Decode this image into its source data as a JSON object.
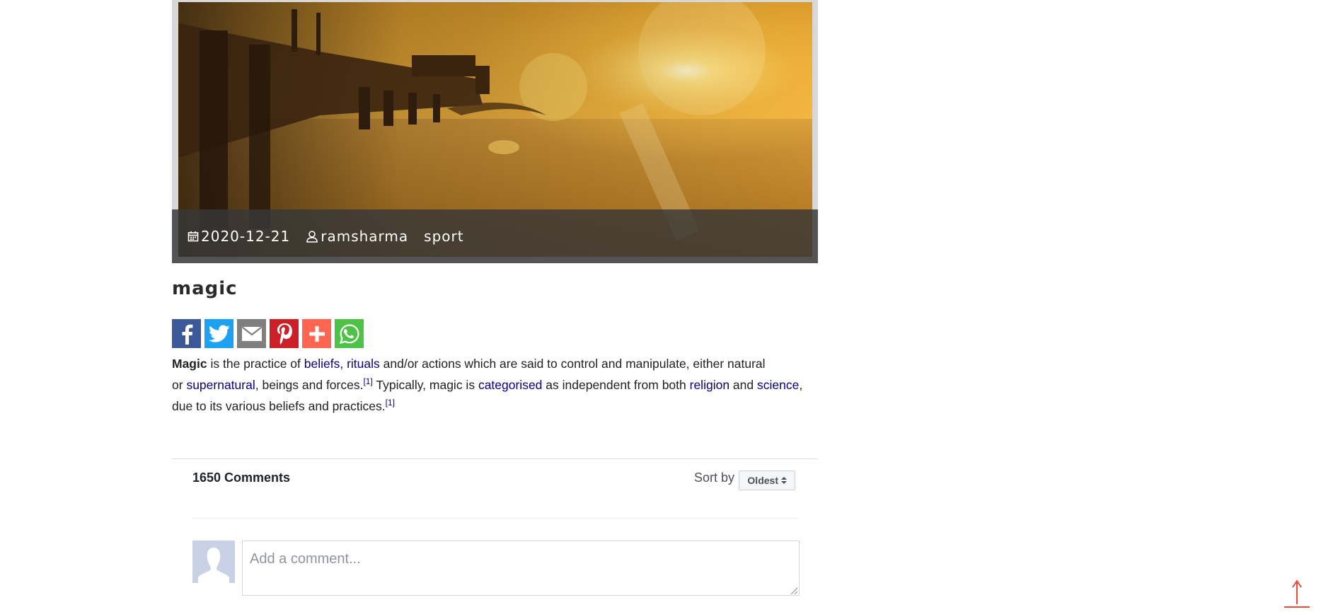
{
  "post": {
    "meta": {
      "date": "2020-12-21",
      "author": "ramsharma",
      "category": "sport"
    },
    "title": "magic",
    "share_buttons": [
      {
        "network": "facebook",
        "icon": "facebook-icon",
        "color": "#3b5998"
      },
      {
        "network": "twitter",
        "icon": "twitter-icon",
        "color": "#1da1f2"
      },
      {
        "network": "email",
        "icon": "email-icon",
        "color": "#7f7f7f"
      },
      {
        "network": "pinterest",
        "icon": "pinterest-icon",
        "color": "#cb2027"
      },
      {
        "network": "more",
        "icon": "plus-icon",
        "color": "#ff6550"
      },
      {
        "network": "whatsapp",
        "icon": "whatsapp-icon",
        "color": "#4dc247"
      }
    ],
    "body": {
      "t0": "Magic",
      "t1": " is the practice of ",
      "l_beliefs": "beliefs",
      "t2": ", ",
      "l_rituals": "rituals",
      "t3": " and/or actions which are said to control and manipulate, either natural",
      "t4": "or ",
      "l_supernatural": "supernatural",
      "t5": ", beings and forces.",
      "ref1": "[1]",
      "t6": " Typically, magic is ",
      "l_categorised": "categorised",
      "t7": " as independent from both ",
      "l_religion": "religion",
      "t8": " and ",
      "l_science": "science",
      "t9": ",",
      "t10": "due to its various beliefs and practices.",
      "ref2": "[1]"
    }
  },
  "comments": {
    "count_label": "1650 Comments",
    "sort_label": "Sort by",
    "sort_value": "Oldest",
    "input_placeholder": "Add a comment..."
  },
  "back_to_top": {
    "icon": "arrow-up-icon",
    "color": "#e74c3c"
  },
  "colors": {
    "link": "#0b0080",
    "meta_bar": "#373737"
  }
}
